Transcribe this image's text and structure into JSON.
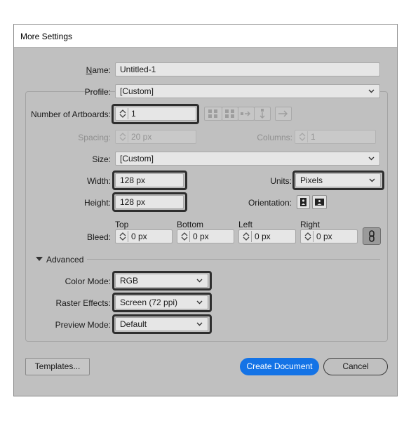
{
  "window": {
    "title": "More Settings"
  },
  "name": {
    "label": "Name:",
    "value": "Untitled-1"
  },
  "profile": {
    "label": "Profile:",
    "value": "[Custom]"
  },
  "artboards": {
    "label": "Number of Artboards:",
    "value": "1"
  },
  "spacing": {
    "label": "Spacing:",
    "value": "20 px"
  },
  "columns": {
    "label": "Columns:",
    "value": "1"
  },
  "size": {
    "label": "Size:",
    "value": "[Custom]"
  },
  "width": {
    "label": "Width:",
    "value": "128 px"
  },
  "units": {
    "label": "Units:",
    "value": "Pixels"
  },
  "height": {
    "label": "Height:",
    "value": "128 px"
  },
  "orientation": {
    "label": "Orientation:"
  },
  "bleed": {
    "label": "Bleed:",
    "top": {
      "label": "Top",
      "value": "0 px"
    },
    "bottom": {
      "label": "Bottom",
      "value": "0 px"
    },
    "left": {
      "label": "Left",
      "value": "0 px"
    },
    "right": {
      "label": "Right",
      "value": "0 px"
    }
  },
  "advanced": {
    "label": "Advanced"
  },
  "color_mode": {
    "label": "Color Mode:",
    "value": "RGB"
  },
  "raster_effects": {
    "label": "Raster Effects:",
    "value": "Screen (72 ppi)"
  },
  "preview_mode": {
    "label": "Preview Mode:",
    "value": "Default"
  },
  "buttons": {
    "templates": "Templates...",
    "create": "Create Document",
    "cancel": "Cancel"
  },
  "colors": {
    "accent": "#1473e6",
    "dialog_bg": "#c0c0c0",
    "highlight": "#2e2e2e"
  }
}
